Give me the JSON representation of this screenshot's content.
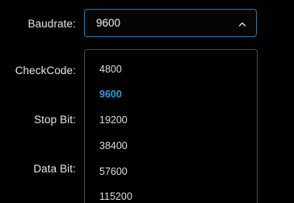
{
  "form": {
    "baudrate_label": "Baudrate:",
    "checkcode_label": "CheckCode:",
    "stopbit_label": "Stop Bit:",
    "databit_label": "Data Bit:"
  },
  "baudrate_select": {
    "value": "9600",
    "expanded": true,
    "chevron_icon": "chevron-up-icon",
    "options": [
      "4800",
      "9600",
      "19200",
      "38400",
      "57600",
      "115200"
    ],
    "selected_index": 1
  },
  "colors": {
    "background": "#000000",
    "accent": "#1ba1e2",
    "focus_border": "#0f7fbf",
    "text": "#e8e8e8"
  }
}
